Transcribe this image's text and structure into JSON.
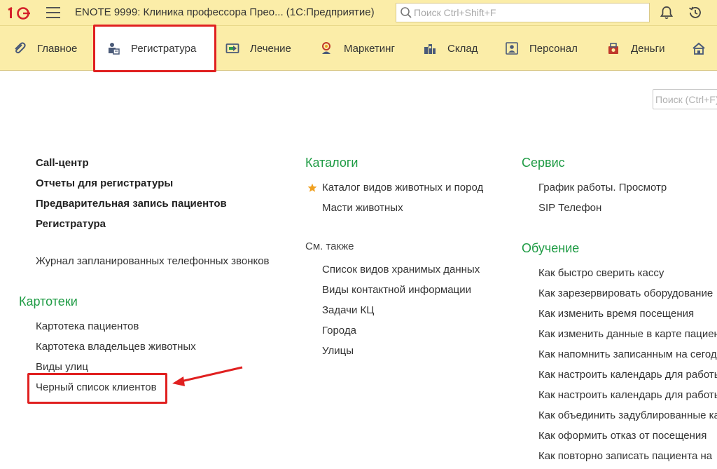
{
  "titlebar": {
    "logo_text": "1С",
    "title": "ENOTE 9999: Клиника профессора Прео... (1С:Предприятие)",
    "search_placeholder": "Поиск Ctrl+Shift+F"
  },
  "sections": [
    {
      "label": "Главное",
      "icon": "paperclip-icon"
    },
    {
      "label": "Регистратура",
      "icon": "reception-icon",
      "active": true
    },
    {
      "label": "Лечение",
      "icon": "treatment-icon"
    },
    {
      "label": "Маркетинг",
      "icon": "marketing-icon"
    },
    {
      "label": "Склад",
      "icon": "warehouse-icon"
    },
    {
      "label": "Персонал",
      "icon": "staff-icon"
    },
    {
      "label": "Деньги",
      "icon": "money-icon"
    }
  ],
  "content": {
    "search_placeholder": "Поиск (Ctrl+F)",
    "main_items": [
      "Call-центр",
      "Отчеты для регистратуры",
      "Предварительная запись пациентов",
      "Регистратура"
    ],
    "journal_item": "Журнал запланированных телефонных звонков",
    "kartoteki": {
      "title": "Картотеки",
      "items": [
        "Картотека пациентов",
        "Картотека владельцев животных",
        "Виды улиц",
        "Черный список клиентов"
      ]
    },
    "katalogi": {
      "title": "Каталоги",
      "items": [
        "Каталог видов животных и пород",
        "Масти животных"
      ]
    },
    "sm_takzhe": {
      "title": "См. также",
      "items": [
        "Список видов хранимых данных",
        "Виды контактной информации",
        "Задачи КЦ",
        "Города",
        "Улицы"
      ]
    },
    "servis": {
      "title": "Сервис",
      "items": [
        "График работы. Просмотр",
        "SIP Телефон"
      ]
    },
    "obuchenie": {
      "title": "Обучение",
      "items": [
        "Как быстро сверить кассу",
        "Как зарезервировать оборудование",
        "Как изменить время посещения",
        "Как изменить данные в карте пациента",
        "Как напомнить записанным на сегодня",
        "Как настроить календарь для работы",
        "Как настроить календарь для работы",
        "Как объединить задублированные карты",
        "Как оформить отказ от посещения",
        "Как повторно записать пациента на"
      ]
    }
  },
  "colors": {
    "panel": "#fbeda8",
    "group_title": "#1e9b44",
    "highlight": "#e02020",
    "star": "#f0a020"
  }
}
